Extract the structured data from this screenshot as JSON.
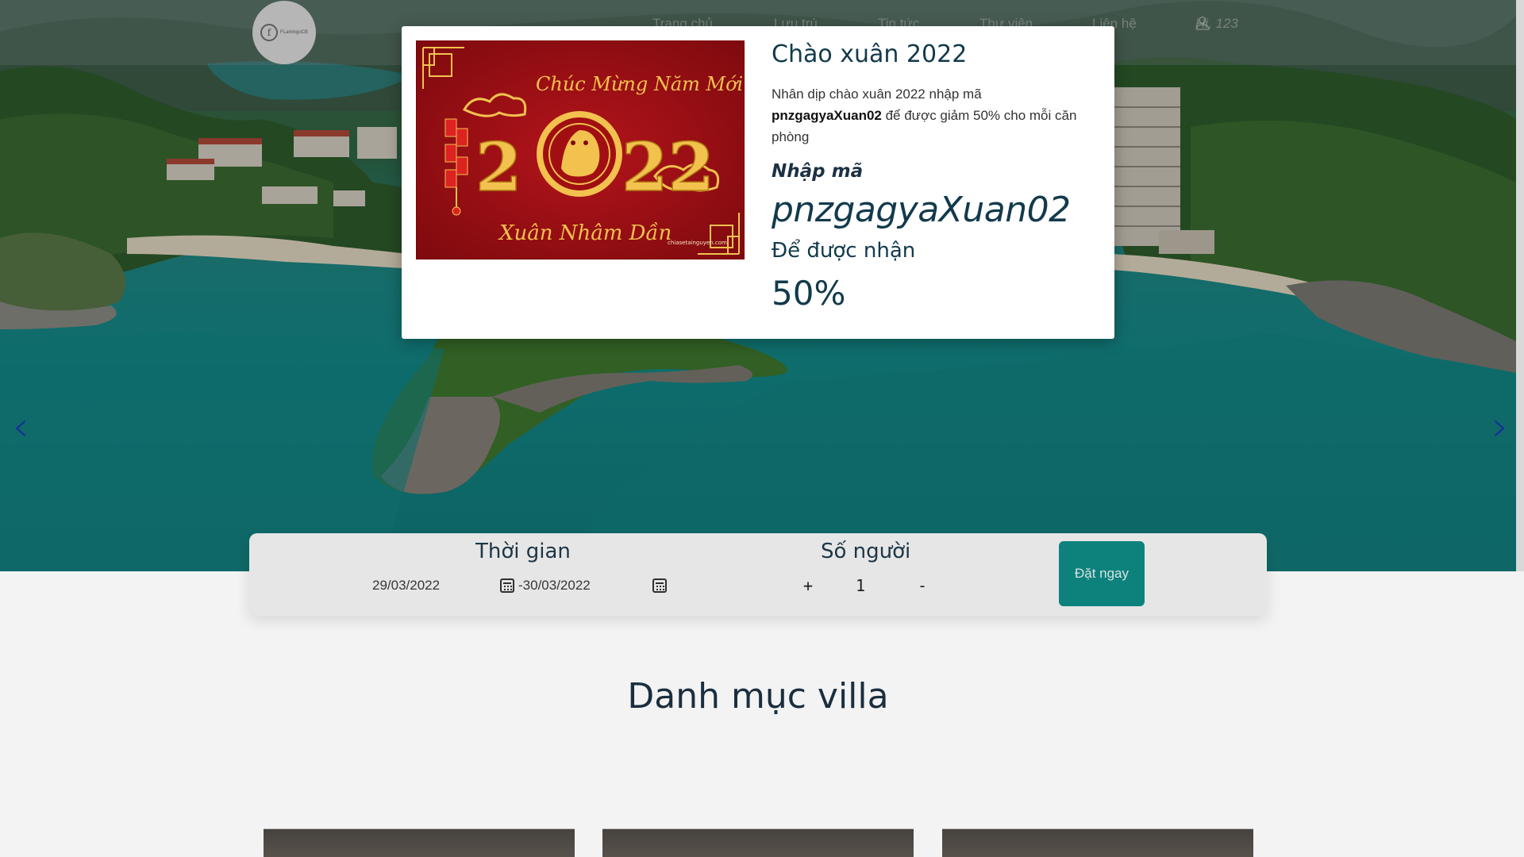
{
  "navbar": {
    "logo_text": "FLamingoCB",
    "links": [
      "Trang chủ",
      "Lưu trú",
      "Tin tức",
      "Thư viện",
      "Liên hệ"
    ],
    "user_greeting": "Hi, 123"
  },
  "hero": {
    "prev_arrow": "‹",
    "next_arrow": "›"
  },
  "booking": {
    "time_label": "Thời gian",
    "date_from": "29/03/2022",
    "date_to": "-30/03/2022",
    "people_label": "Số người",
    "plus": "+",
    "people_count": "1",
    "minus": "-",
    "book_button": "Đặt ngay"
  },
  "section": {
    "title": "Danh mục villa"
  },
  "modal": {
    "title": "Chào xuân 2022",
    "desc_before": "Nhân dịp chào xuân 2022 nhập mã ",
    "desc_code": "pnzgagyaXuan02",
    "desc_after": " để được giảm 50% cho mỗi căn phòng",
    "enter_code_label": "Nhập mã",
    "code": "pnzgagyaXuan02",
    "receive_label": "Để được nhận",
    "percent": "50%",
    "image": {
      "top_text": "Chúc Mừng Năm Mới",
      "year_left": "2",
      "year_right": "22",
      "bottom_text": "Xuân Nhâm Dần",
      "watermark": "chiasetainguyen.com"
    }
  },
  "colors": {
    "accent": "#0e8c86",
    "heading": "#123a4c",
    "promo_red": "#a30d0d",
    "promo_gold": "#f2c14e"
  }
}
